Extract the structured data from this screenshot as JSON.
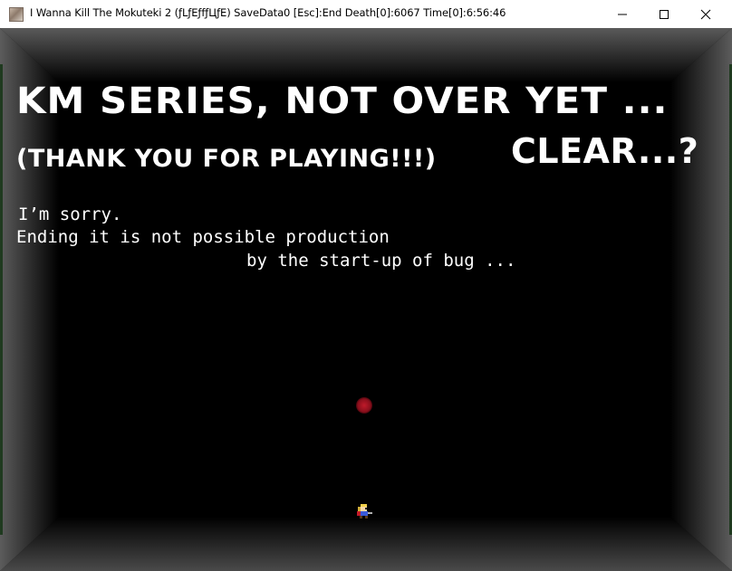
{
  "window": {
    "title": "I Wanna Kill The Mokuteki 2 (ƒLƒEƒfƒЦƒE)  SaveData0  [Esc]:End  Death[0]:6067 Time[0]:6:56:46",
    "minimize_icon": "minimize-icon",
    "maximize_icon": "maximize-icon",
    "close_icon": "close-icon"
  },
  "game": {
    "headline_line1": "KM SERIES, NOT OVER YET ...",
    "headline_line2_small": "(THANK YOU FOR PLAYING!!!)",
    "headline_line2_big": "CLEAR...?",
    "message_line1": "I’m sorry.",
    "message_line2": "Ending it is not possible production",
    "message_line3": "by the start-up of bug ...",
    "colors": {
      "background": "#000000",
      "text": "#ffffff",
      "orb": "#b0101f",
      "wall_light": "#5a5a5a"
    }
  }
}
